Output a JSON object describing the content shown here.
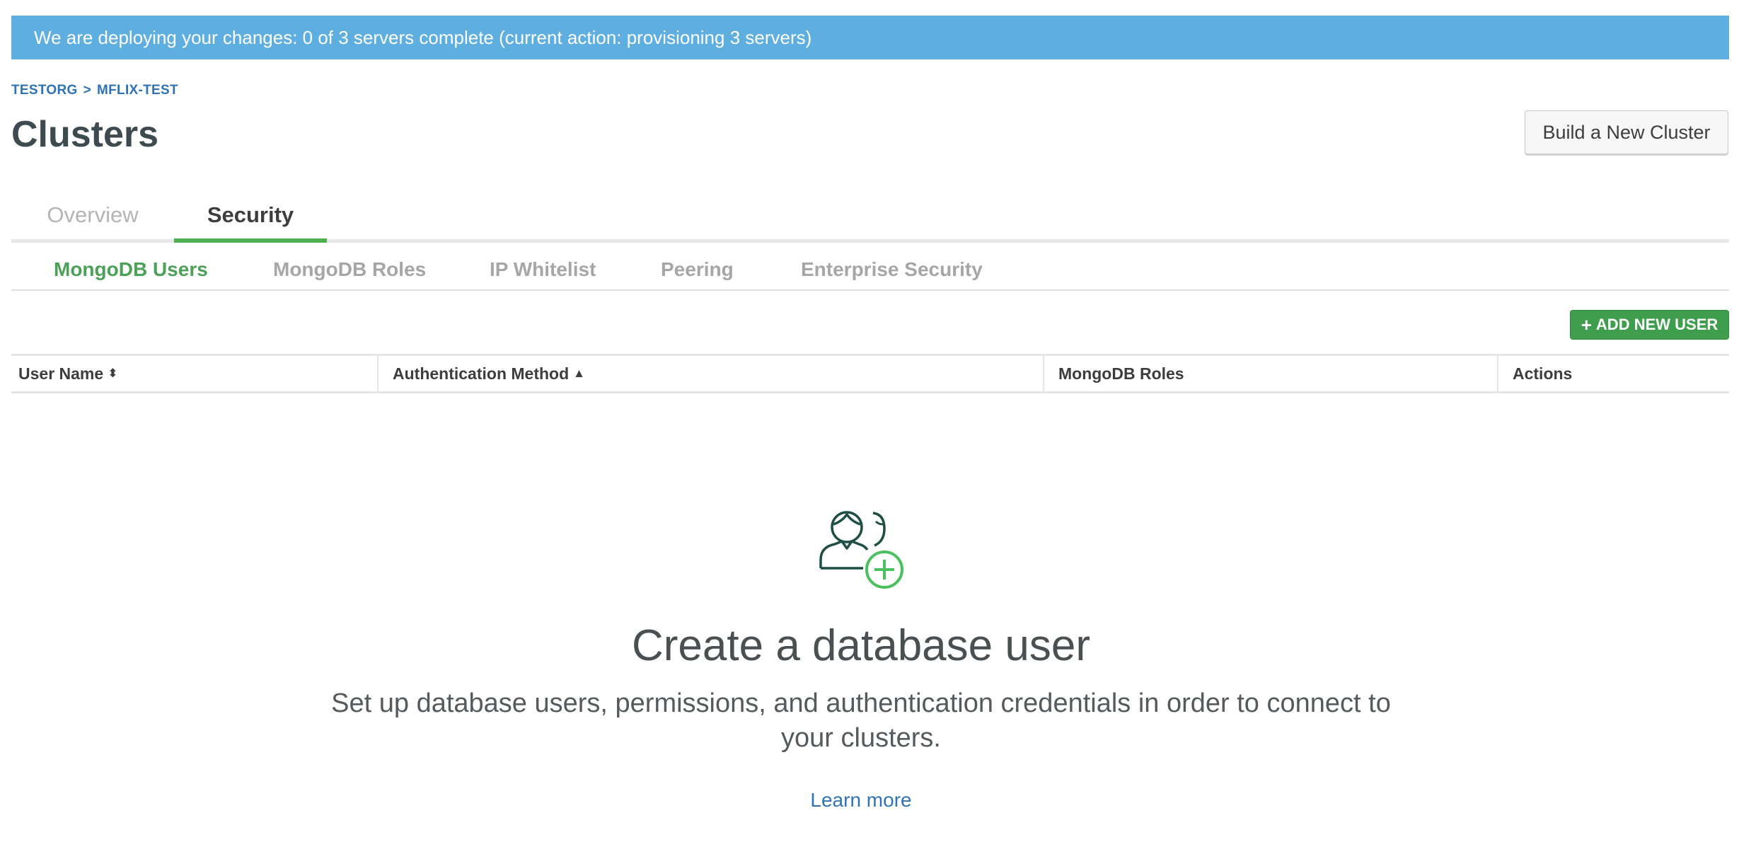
{
  "banner": {
    "message": "We are deploying your changes: 0 of 3 servers complete (current action: provisioning 3 servers)"
  },
  "breadcrumb": {
    "org": "TESTORG",
    "separator": ">",
    "project": "MFLIX-TEST"
  },
  "header": {
    "title": "Clusters",
    "build_button_label": "Build a New Cluster"
  },
  "main_tabs": [
    {
      "label": "Overview",
      "active": false
    },
    {
      "label": "Security",
      "active": true
    }
  ],
  "sub_tabs": [
    {
      "label": "MongoDB Users",
      "active": true
    },
    {
      "label": "MongoDB Roles",
      "active": false
    },
    {
      "label": "IP Whitelist",
      "active": false
    },
    {
      "label": "Peering",
      "active": false
    },
    {
      "label": "Enterprise Security",
      "active": false
    }
  ],
  "toolbar": {
    "add_user_label": "ADD NEW USER",
    "add_user_icon": "+"
  },
  "table": {
    "columns": [
      {
        "label": "User Name",
        "sort_icon": "⬍"
      },
      {
        "label": "Authentication Method",
        "sort_icon": "▲"
      },
      {
        "label": "MongoDB Roles"
      },
      {
        "label": "Actions"
      }
    ]
  },
  "empty_state": {
    "icon": "add-user-icon",
    "title": "Create a database user",
    "description": "Set up database users, permissions, and authentication credentials in order to connect to your clusters.",
    "link_label": "Learn more"
  },
  "colors": {
    "banner": "#5eaee0",
    "accent_green": "#4caf50",
    "link_blue": "#2e74b5",
    "button_green": "#3f9e4d"
  }
}
